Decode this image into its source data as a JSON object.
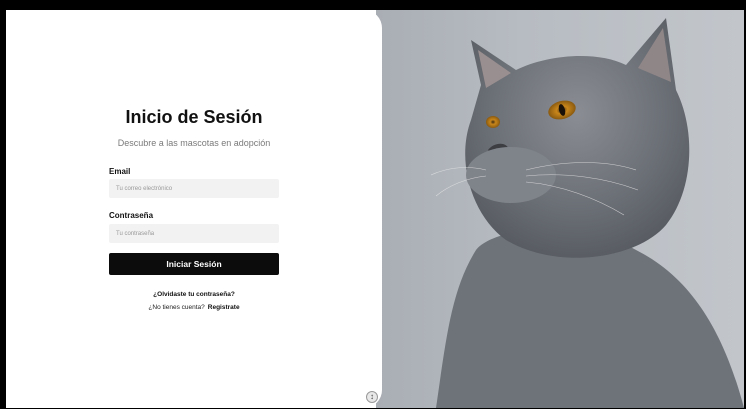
{
  "login": {
    "title": "Inicio de Sesión",
    "subtitle": "Descubre a las mascotas en adopción",
    "email_label": "Email",
    "email_placeholder": "Tu correo electrónico",
    "password_label": "Contraseña",
    "password_placeholder": "Tu contraseña",
    "submit_label": "Iniciar Sesión",
    "forgot_label": "¿Olvidaste tu contraseña?",
    "no_account_text": "¿No tienes cuenta?",
    "register_label": "Registrate"
  },
  "hero_image": {
    "subject": "gray-cat-photo"
  },
  "colors": {
    "button_bg": "#0c0c0c",
    "input_bg": "#f2f2f2",
    "photo_bg": "#b5b9be"
  },
  "scroll_indicator": {
    "icon": "expand-icon"
  }
}
